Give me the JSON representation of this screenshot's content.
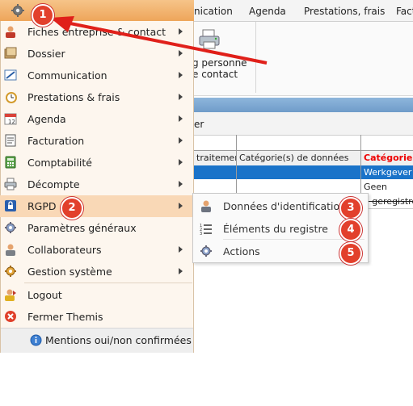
{
  "ribbon": {
    "tabs": [
      "nication",
      "Agenda",
      "Prestations, frais",
      "Fact"
    ],
    "button_line1": "g personne",
    "button_line2": "e contact"
  },
  "subbar": {
    "text": "er"
  },
  "grid": {
    "headers": [
      "traitement",
      "Catégorie(s) de données",
      "Catégorie(s"
    ],
    "rows": [
      [
        "",
        "",
        "Werkgever o"
      ],
      [
        "",
        "",
        "Geen"
      ],
      [
        "",
        "",
        "e geregistre"
      ]
    ]
  },
  "main_menu": {
    "items": [
      {
        "label": "Fiches entreprise & contact",
        "icon": "contact-icon",
        "submenu": true
      },
      {
        "label": "Dossier",
        "icon": "dossier-icon",
        "submenu": true
      },
      {
        "label": "Communication",
        "icon": "communication-icon",
        "submenu": true
      },
      {
        "label": "Prestations & frais",
        "icon": "clock-icon",
        "submenu": true
      },
      {
        "label": "Agenda",
        "icon": "calendar-icon",
        "submenu": true
      },
      {
        "label": "Facturation",
        "icon": "invoice-icon",
        "submenu": true
      },
      {
        "label": "Comptabilité",
        "icon": "calculator-icon",
        "submenu": true
      },
      {
        "label": "Décompte",
        "icon": "printer-icon",
        "submenu": true
      },
      {
        "label": "RGPD",
        "icon": "lock-icon",
        "submenu": true
      },
      {
        "label": "Paramètres généraux",
        "icon": "gear-icon",
        "submenu": false
      },
      {
        "label": "Collaborateurs",
        "icon": "user-icon",
        "submenu": true
      },
      {
        "label": "Gestion système",
        "icon": "system-gear-icon",
        "submenu": true
      },
      {
        "label": "Logout",
        "icon": "logout-icon",
        "submenu": false
      },
      {
        "label": "Fermer Themis",
        "icon": "close-icon",
        "submenu": false
      }
    ],
    "footer": "Mentions oui/non confirmées"
  },
  "rgpd_submenu": {
    "items": [
      {
        "label": "Données d'identification",
        "icon": "identity-icon"
      },
      {
        "label": "Éléments du registre",
        "icon": "list-icon"
      },
      {
        "label": "Actions",
        "icon": "actions-gear-icon"
      }
    ]
  },
  "annotations": {
    "badges": [
      "1",
      "2",
      "3",
      "4",
      "5"
    ],
    "badge_color": "#e2402c",
    "arrow_color": "#e0201a"
  },
  "colors": {
    "menu_header": "#eea55a",
    "menu_active": "#f9d8b6",
    "selected_row": "#1a73c9"
  }
}
